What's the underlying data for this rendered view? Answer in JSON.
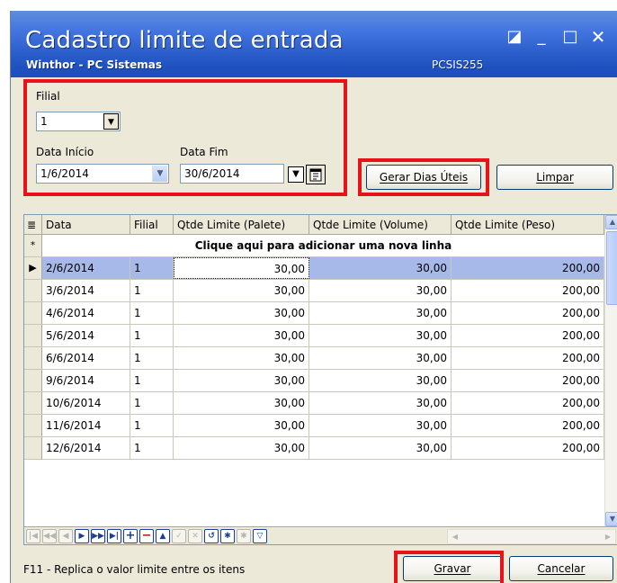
{
  "window": {
    "title": "Cadastro limite de entrada",
    "subtitle": "Winthor - PC Sistemas",
    "code": "PCSIS255",
    "controls": {
      "restore": "◪",
      "minimize": "_",
      "maximize": "□",
      "close": "✕"
    }
  },
  "filters": {
    "filial_label": "Filial",
    "filial_value": "1",
    "data_inicio_label": "Data Início",
    "data_inicio_value": "1/6/2014",
    "data_fim_label": "Data Fim",
    "data_fim_value": "30/6/2014"
  },
  "buttons": {
    "gerar": "Gerar Dias Úteis",
    "limpar": "Limpar",
    "gravar": "Gravar",
    "cancelar": "Cancelar"
  },
  "grid": {
    "columns": [
      "Data",
      "Filial",
      "Qtde Limite (Palete)",
      "Qtde Limite (Volume)",
      "Qtde Limite (Peso)"
    ],
    "new_row_text": "Clique aqui para adicionar uma nova linha",
    "rows": [
      {
        "data": "2/6/2014",
        "filial": "1",
        "palete": "30,00",
        "volume": "30,00",
        "peso": "200,00"
      },
      {
        "data": "3/6/2014",
        "filial": "1",
        "palete": "30,00",
        "volume": "30,00",
        "peso": "200,00"
      },
      {
        "data": "4/6/2014",
        "filial": "1",
        "palete": "30,00",
        "volume": "30,00",
        "peso": "200,00"
      },
      {
        "data": "5/6/2014",
        "filial": "1",
        "palete": "30,00",
        "volume": "30,00",
        "peso": "200,00"
      },
      {
        "data": "6/6/2014",
        "filial": "1",
        "palete": "30,00",
        "volume": "30,00",
        "peso": "200,00"
      },
      {
        "data": "9/6/2014",
        "filial": "1",
        "palete": "30,00",
        "volume": "30,00",
        "peso": "200,00"
      },
      {
        "data": "10/6/2014",
        "filial": "1",
        "palete": "30,00",
        "volume": "30,00",
        "peso": "200,00"
      },
      {
        "data": "11/6/2014",
        "filial": "1",
        "palete": "30,00",
        "volume": "30,00",
        "peso": "200,00"
      },
      {
        "data": "12/6/2014",
        "filial": "1",
        "palete": "30,00",
        "volume": "30,00",
        "peso": "200,00"
      }
    ]
  },
  "status": "F11 - Replica o valor limite entre os itens",
  "colors": {
    "highlight": "#e8121b",
    "title_blue": "#245edb",
    "selection": "#a6b9e8"
  }
}
